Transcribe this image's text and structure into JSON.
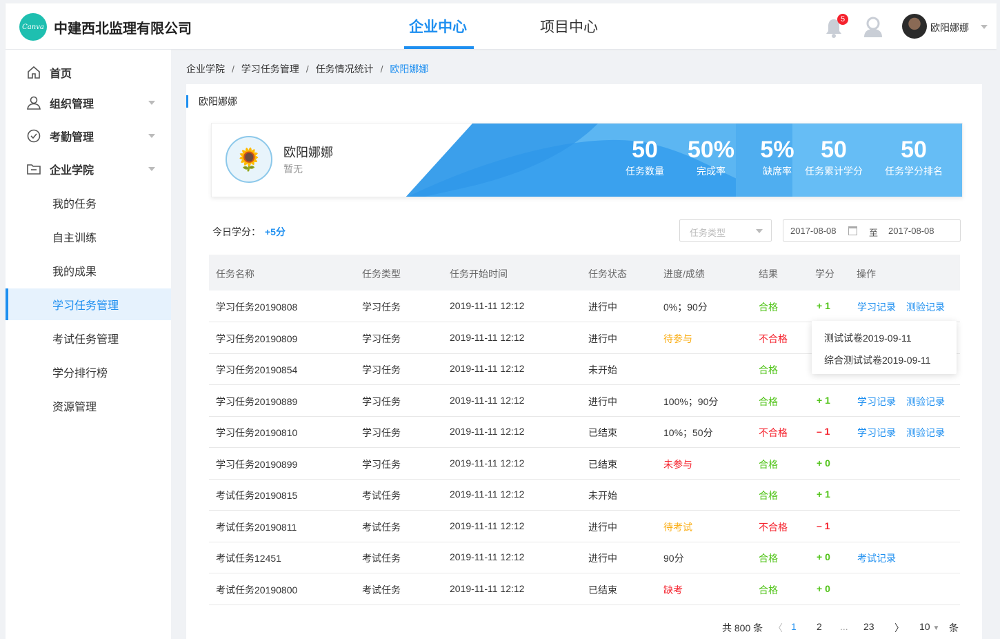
{
  "header": {
    "logo_text": "Canva",
    "company": "中建西北监理有限公司",
    "tabs": [
      "企业中心",
      "项目中心"
    ],
    "notification_count": "5",
    "username": "欧阳娜娜"
  },
  "sidebar": {
    "items": [
      {
        "label": "首页"
      },
      {
        "label": "组织管理"
      },
      {
        "label": "考勤管理"
      },
      {
        "label": "企业学院"
      }
    ],
    "sub_items": [
      {
        "label": "我的任务"
      },
      {
        "label": "自主训练"
      },
      {
        "label": "我的成果"
      },
      {
        "label": "学习任务管理"
      },
      {
        "label": "考试任务管理"
      },
      {
        "label": "学分排行榜"
      },
      {
        "label": "资源管理"
      }
    ]
  },
  "breadcrumb": [
    "企业学院",
    "学习任务管理",
    "任务情况统计",
    "欧阳娜娜"
  ],
  "section_title": "欧阳娜娜",
  "profile": {
    "name": "欧阳娜娜",
    "sub": "暂无"
  },
  "stats": [
    {
      "num": "50",
      "label": "任务数量"
    },
    {
      "num": "50%",
      "label": "完成率"
    },
    {
      "num": "5%",
      "label": "缺席率"
    },
    {
      "num": "50",
      "label": "任务累计学分"
    },
    {
      "num": "50",
      "label": "任务学分排名"
    }
  ],
  "filters": {
    "today_label": "今日学分：",
    "today_value": "+5分",
    "type_placeholder": "任务类型",
    "date_start": "2017-08-08",
    "date_to": "至",
    "date_end": "2017-08-08"
  },
  "table": {
    "headers": [
      "任务名称",
      "任务类型",
      "任务开始时间",
      "任务状态",
      "进度/成绩",
      "结果",
      "学分",
      "操作"
    ],
    "rows": [
      {
        "name": "学习任务20190808",
        "type": "学习任务",
        "time": "2019-11-11  12:12",
        "status": "进行中",
        "progress": "0%；90分",
        "progress_style": "",
        "result": "合格",
        "result_style": "ok",
        "credit": "+ 1",
        "credit_style": "plus",
        "actions": [
          "学习记录",
          "测验记录"
        ]
      },
      {
        "name": "学习任务20190809",
        "type": "学习任务",
        "time": "2019-11-11  12:12",
        "status": "进行中",
        "progress": "待参与",
        "progress_style": "warn",
        "result": "不合格",
        "result_style": "bad",
        "credit": "",
        "credit_style": "",
        "actions": []
      },
      {
        "name": "学习任务20190854",
        "type": "学习任务",
        "time": "2019-11-11  12:12",
        "status": "未开始",
        "progress": "",
        "progress_style": "",
        "result": "合格",
        "result_style": "ok",
        "credit": "",
        "credit_style": "",
        "actions": []
      },
      {
        "name": "学习任务20190889",
        "type": "学习任务",
        "time": "2019-11-11  12:12",
        "status": "进行中",
        "progress": "100%；90分",
        "progress_style": "",
        "result": "合格",
        "result_style": "ok",
        "credit": "+ 1",
        "credit_style": "plus",
        "actions": [
          "学习记录",
          "测验记录"
        ]
      },
      {
        "name": "学习任务20190810",
        "type": "学习任务",
        "time": "2019-11-11  12:12",
        "status": "已结束",
        "progress": "10%；50分",
        "progress_style": "",
        "result": "不合格",
        "result_style": "bad",
        "credit": "– 1",
        "credit_style": "minus",
        "actions": [
          "学习记录",
          "测验记录"
        ]
      },
      {
        "name": "学习任务20190899",
        "type": "学习任务",
        "time": "2019-11-11  12:12",
        "status": "已结束",
        "progress": "未参与",
        "progress_style": "bad",
        "result": "合格",
        "result_style": "ok",
        "credit": "+ 0",
        "credit_style": "plus",
        "actions": []
      },
      {
        "name": "考试任务20190815",
        "type": "考试任务",
        "time": "2019-11-11  12:12",
        "status": "未开始",
        "progress": "",
        "progress_style": "",
        "result": "合格",
        "result_style": "ok",
        "credit": "+ 1",
        "credit_style": "plus",
        "actions": []
      },
      {
        "name": "考试任务20190811",
        "type": "考试任务",
        "time": "2019-11-11  12:12",
        "status": "进行中",
        "progress": "待考试",
        "progress_style": "warn",
        "result": "不合格",
        "result_style": "bad",
        "credit": "– 1",
        "credit_style": "minus",
        "actions": []
      },
      {
        "name": "考试任务12451",
        "type": "考试任务",
        "time": "2019-11-11  12:12",
        "status": "进行中",
        "progress": "90分",
        "progress_style": "",
        "result": "合格",
        "result_style": "ok",
        "credit": "+ 0",
        "credit_style": "plus",
        "actions": [
          "考试记录"
        ]
      },
      {
        "name": "考试任务20190800",
        "type": "考试任务",
        "time": "2019-11-11  12:12",
        "status": "已结束",
        "progress": "缺考",
        "progress_style": "bad",
        "result": "合格",
        "result_style": "ok",
        "credit": "+ 0",
        "credit_style": "plus",
        "actions": []
      }
    ]
  },
  "popover": {
    "items": [
      "测试试卷2019-09-11",
      "综合测试试卷2019-09-11"
    ]
  },
  "pagination": {
    "total_prefix": "共",
    "total": "800",
    "total_suffix": "条",
    "pages": [
      "1",
      "2",
      "...",
      "23"
    ],
    "current": "1",
    "page_size": "10",
    "page_size_suffix": "条"
  },
  "colors": {
    "accent": "#1e8ff0",
    "pass": "#52c41a",
    "fail": "#f5222d",
    "pending": "#faad14"
  }
}
